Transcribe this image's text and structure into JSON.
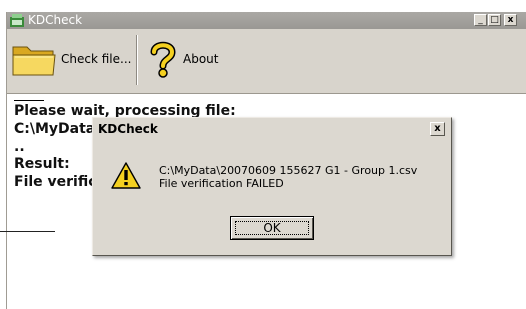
{
  "window": {
    "title": "KDCheck",
    "controls": {
      "minimize": "_",
      "maximize": "□",
      "close": "x"
    }
  },
  "toolbar": {
    "check_file_label": "Check file...",
    "check_file_icon": "folder-icon",
    "about_label": "About",
    "about_icon": "help-icon"
  },
  "output": {
    "dash": "—",
    "line1": "Please wait, processing file:",
    "line2": "C:\\MyData\\20070609 155627 G1 - Group 1.csv",
    "line3": "..",
    "line4": "Result:",
    "line5": "File verification FAILED"
  },
  "dialog": {
    "title": "KDCheck",
    "close_label": "x",
    "icon": "warning-icon",
    "message_line1": "C:\\MyData\\20070609 155627 G1 - Group 1.csv",
    "message_line2": "File verification FAILED",
    "ok_label": "OK"
  },
  "colors": {
    "window_bg": "#d8d4cc",
    "content_bg": "#ffffff",
    "warning_yellow": "#f4d020",
    "folder_yellow": "#f0c840"
  }
}
